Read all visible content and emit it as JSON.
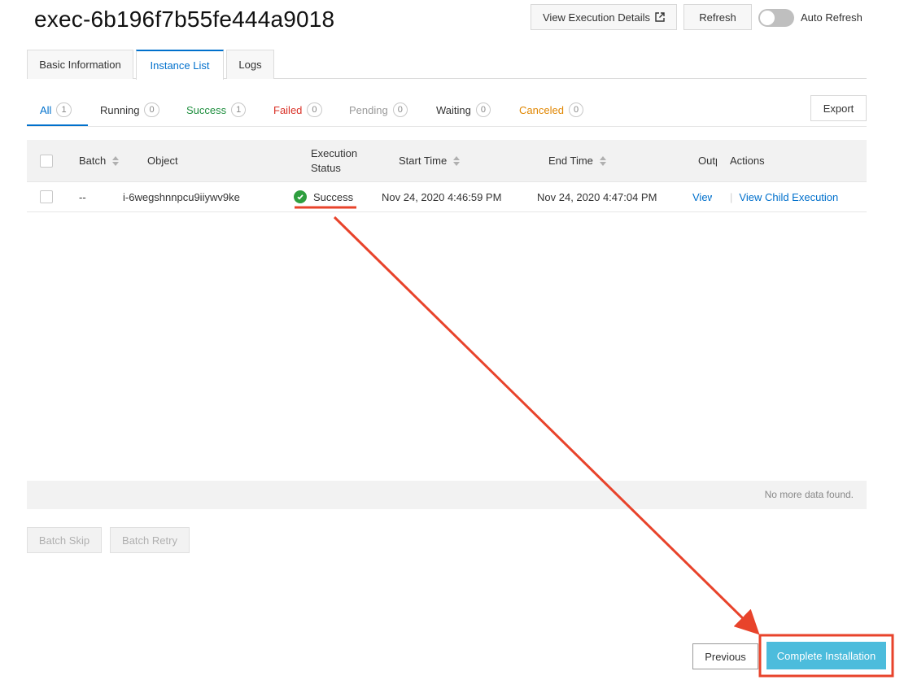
{
  "header": {
    "title": "exec-6b196f7b55fe444a9018",
    "view_details_label": "View Execution Details",
    "refresh_label": "Refresh",
    "auto_refresh_label": "Auto Refresh",
    "auto_refresh_on": false
  },
  "tabs": [
    {
      "label": "Basic Information",
      "active": false
    },
    {
      "label": "Instance List",
      "active": true
    },
    {
      "label": "Logs",
      "active": false
    }
  ],
  "filters": [
    {
      "label": "All",
      "count": "1",
      "active": true
    },
    {
      "label": "Running",
      "count": "0"
    },
    {
      "label": "Success",
      "count": "1"
    },
    {
      "label": "Failed",
      "count": "0"
    },
    {
      "label": "Pending",
      "count": "0"
    },
    {
      "label": "Waiting",
      "count": "0"
    },
    {
      "label": "Canceled",
      "count": "0"
    }
  ],
  "export_label": "Export",
  "table": {
    "columns": {
      "batch": "Batch",
      "object": "Object",
      "status_line1": "Execution",
      "status_line2": "Status",
      "start_time": "Start Time",
      "end_time": "End Time",
      "output": "Output",
      "actions": "Actions"
    },
    "rows": [
      {
        "batch": "--",
        "object": "i-6wegshnnpcu9iiywv9ke",
        "status": "Success",
        "start_time": "Nov 24, 2020 4:46:59 PM",
        "end_time": "Nov 24, 2020 4:47:04 PM",
        "output_link": "View",
        "action_link": "View Child Execution"
      }
    ],
    "empty_text": "No more data found."
  },
  "batch_skip_label": "Batch Skip",
  "batch_retry_label": "Batch Retry",
  "footer": {
    "previous_label": "Previous",
    "complete_label": "Complete Installation"
  },
  "colors": {
    "link": "#0070cc",
    "success": "#1e8e3e",
    "failed": "#d93026",
    "canceled": "#e08600",
    "primary_button": "#4cbcdc",
    "annotation": "#e8432b"
  }
}
